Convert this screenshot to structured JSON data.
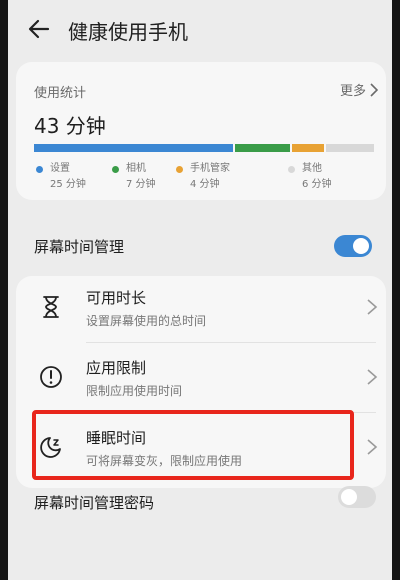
{
  "header": {
    "title": "健康使用手机",
    "back_icon": "arrow-left-icon"
  },
  "usage": {
    "label": "使用统计",
    "more": "更多",
    "total": "43 分钟",
    "categories": [
      {
        "name": "设置",
        "value": "25 分钟",
        "minutes": 25,
        "color": "#3b87d3"
      },
      {
        "name": "相机",
        "value": "7 分钟",
        "minutes": 7,
        "color": "#3a9c48"
      },
      {
        "name": "手机管家",
        "value": "4 分钟",
        "minutes": 4,
        "color": "#e8a234"
      },
      {
        "name": "其他",
        "value": "6 分钟",
        "minutes": 6,
        "color": "#d8d8d8"
      }
    ]
  },
  "screen_time": {
    "label": "屏幕时间管理",
    "enabled": true,
    "toggle_on_color": "#3b87d3"
  },
  "items": [
    {
      "title": "可用时长",
      "subtitle": "设置屏幕使用的总时间",
      "icon": "hourglass-icon"
    },
    {
      "title": "应用限制",
      "subtitle": "限制应用使用时间",
      "icon": "alert-circle-icon"
    },
    {
      "title": "睡眠时间",
      "subtitle": "可将屏幕变灰，限制应用使用",
      "icon": "moon-sleep-icon"
    }
  ],
  "password": {
    "label": "屏幕时间管理密码",
    "enabled": false
  }
}
